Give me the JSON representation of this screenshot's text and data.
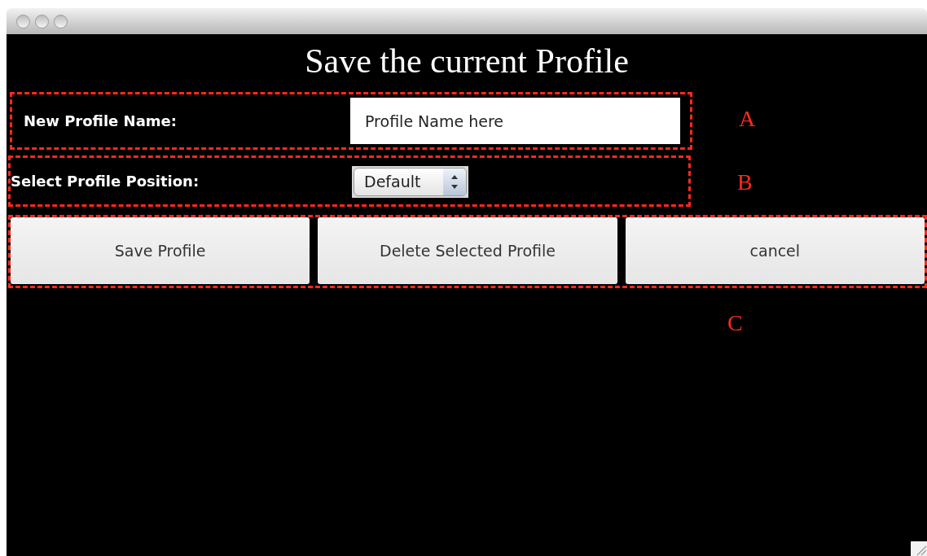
{
  "heading": "Save the current Profile",
  "sections": [
    {
      "marker": "A",
      "label": "New Profile Name:",
      "kind": "text",
      "value": "Profile Name here"
    },
    {
      "marker": "B",
      "label": "Select Profile Position:",
      "kind": "select",
      "value": "Default"
    }
  ],
  "button_group": {
    "marker": "C",
    "buttons": [
      "Save Profile",
      "Delete Selected Profile",
      "cancel"
    ]
  }
}
